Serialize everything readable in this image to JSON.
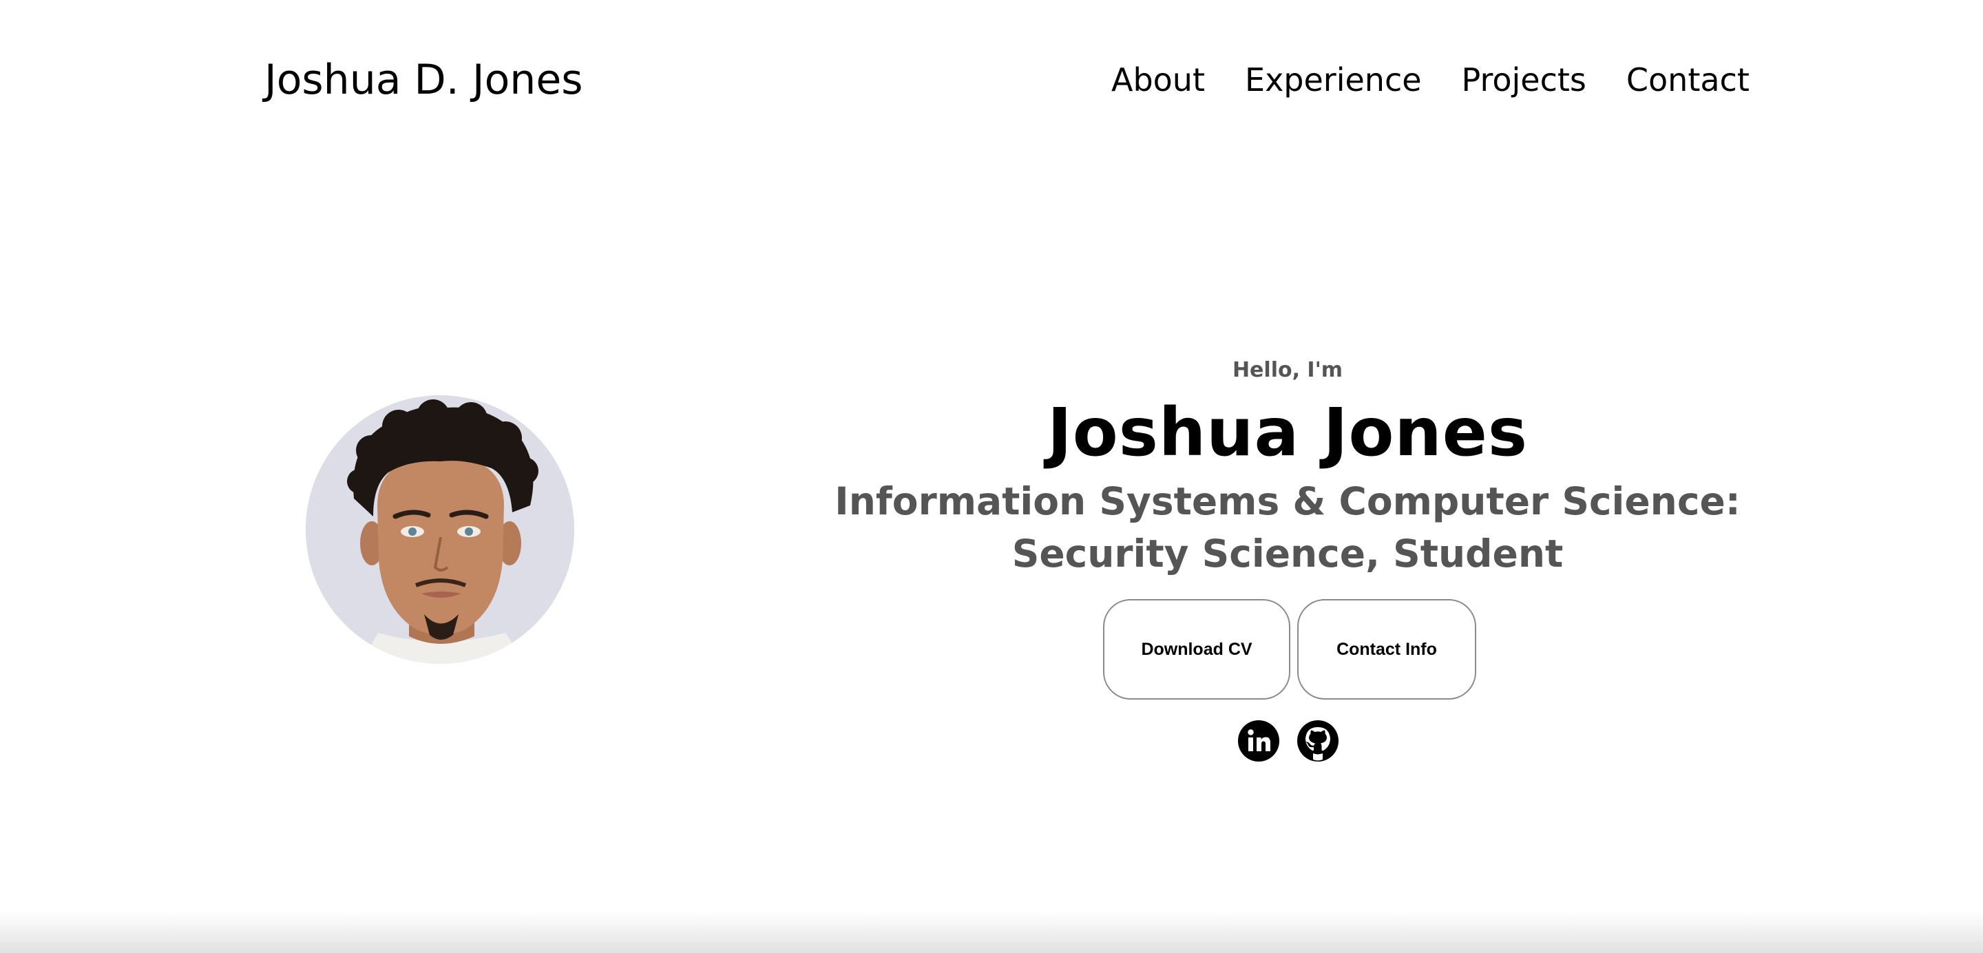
{
  "nav": {
    "logo": "Joshua D. Jones",
    "links": [
      {
        "label": "About"
      },
      {
        "label": "Experience"
      },
      {
        "label": "Projects"
      },
      {
        "label": "Contact"
      }
    ]
  },
  "hero": {
    "greeting": "Hello, I'm",
    "name": "Joshua Jones",
    "subtitle": "Information Systems & Computer Science: Security Science, Student",
    "buttons": {
      "download_cv": "Download CV",
      "contact_info": "Contact Info"
    },
    "socials": [
      {
        "icon": "linkedin-icon"
      },
      {
        "icon": "github-icon"
      }
    ]
  },
  "colors": {
    "text": "#000000",
    "muted": "#555555",
    "button_border": "#8a8a8a",
    "avatar_bg": "#dcdde6"
  }
}
